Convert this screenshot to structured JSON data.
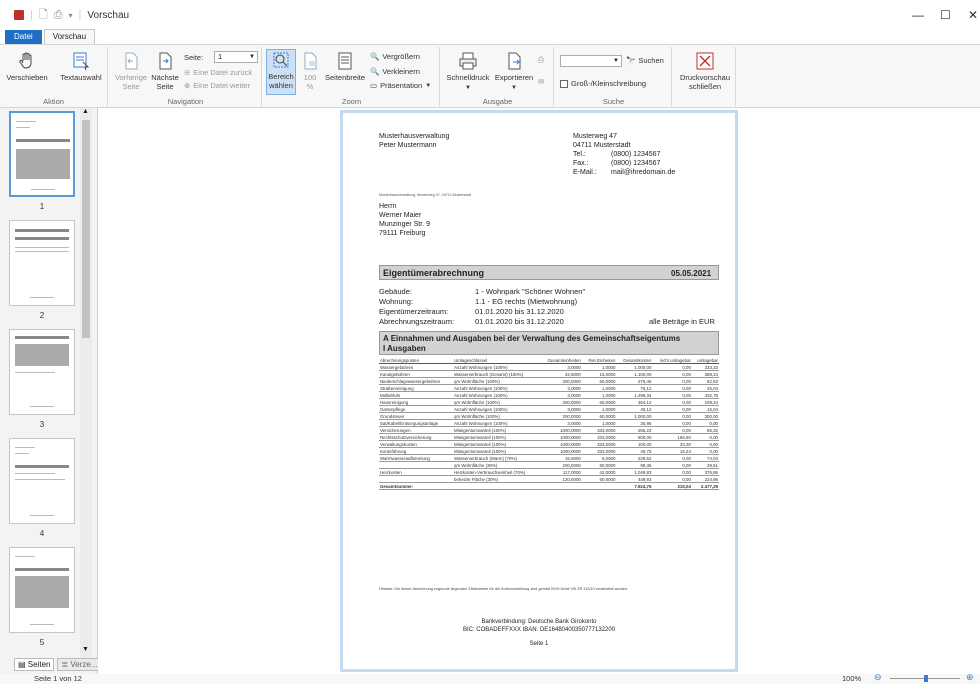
{
  "window": {
    "title": "Vorschau"
  },
  "tabs": {
    "file": "Datei",
    "preview": "Vorschau"
  },
  "ribbon": {
    "aktion": {
      "label": "Aktion",
      "move": "Verschieben",
      "text_select": "Textauswahl"
    },
    "navigation": {
      "label": "Navigation",
      "prev_page_1": "Vorherige",
      "prev_page_2": "Seite",
      "next_page_1": "Nächste",
      "next_page_2": "Seite",
      "page_label": "Seite:",
      "page_value": "1",
      "file_back": "Eine Datei zurück",
      "file_forward": "Eine Datei weiter"
    },
    "zoom": {
      "label": "Zoom",
      "area_1": "Bereich",
      "area_2": "wählen",
      "hundred_1": "100",
      "hundred_2": "%",
      "page_width": "Seitenbreite",
      "zoom_in": "Vergrößern",
      "zoom_out": "Verkleinern",
      "presentation": "Präsentation"
    },
    "ausgabe": {
      "label": "Ausgabe",
      "quick_print": "Schnelldruck",
      "export": "Exportieren"
    },
    "suche": {
      "label": "Suche",
      "search": "Suchen",
      "case": "Groß-/Kleinschreibung",
      "search_value": ""
    },
    "close": {
      "line1": "Druckvorschau",
      "line2": "schließen"
    }
  },
  "sidebar": {
    "pages": [
      "1",
      "2",
      "3",
      "4",
      "5"
    ],
    "tab_pages": "Seiten",
    "tab_directory": "Verze..."
  },
  "status": {
    "page_info": "Seite 1 von 12",
    "zoom": "100%"
  },
  "document": {
    "sender_name": "Musterhausverwaltung",
    "sender_person": "Peter Mustermann",
    "sender_street": "Musterweg 47",
    "sender_city": "04711 Musterstadt",
    "tel_label": "Tel.:",
    "tel": "(0800) 1234567",
    "fax_label": "Fax.:",
    "fax": "(0800) 1234567",
    "mail_label": "E-Mail.:",
    "mail": "mail@ihredomain.de",
    "return_line": "Musterhausverwaltung, Musterweg 47, 04711 Musterstadt",
    "recipient": [
      "Herrn",
      "Werner Maier",
      "Munzinger Str. 9",
      "79111 Freiburg"
    ],
    "heading": "Eigentümerabrechnung",
    "heading_date": "05.05.2021",
    "building_label": "Gebäude:",
    "building": "1 - Wohnpark \"Schöner Wohnen\"",
    "apartment_label": "Wohnung:",
    "apartment": "1.1 - EG rechts (Mietwohnung)",
    "owner_period_label": "Eigentümerzeitraum:",
    "owner_period": "01.01.2020 bis 31.12.2020",
    "billing_period_label": "Abrechnungszeitraum:",
    "billing_period": "01.01.2020 bis 31.12.2020",
    "currency_note": "alle Beträge in EUR",
    "section_title_1": "A Einnahmen und Ausgaben bei der Verwaltung des Gemeinschaftseigentums",
    "section_title_2": "I Ausgaben",
    "table_headers": [
      "Abrechnungsposten",
      "Umlageschlüssel",
      "Gesamteinheiten",
      "Ihre Einheiten",
      "Gesamtkosten",
      "nicht umlagebar",
      "umlagebar"
    ],
    "table_rows": [
      [
        "Wassergebühren",
        "Anzahl Wohnungen (100%)",
        "3,0000",
        "1,0000",
        "1.000,00",
        "0,00",
        "333,33"
      ],
      [
        "Kanalgebühren",
        "Wasserverbrauch (Gesamt) (100%)",
        "42,5000",
        "15,0000",
        "1.100,00",
        "0,00",
        "388,24"
      ],
      [
        "Niederschlagswassergebühren",
        "qm Wohnfläche (100%)",
        "200,0000",
        "60,0000",
        "276,45",
        "0,00",
        "82,93"
      ],
      [
        "Straßenreinigung",
        "Anzahl Wohnungen (100%)",
        "3,0000",
        "1,0000",
        "75,12",
        "0,00",
        "25,04"
      ],
      [
        "Müllabfuhr",
        "Anzahl Wohnungen (100%)",
        "3,0000",
        "1,0000",
        "1.298,34",
        "0,00",
        "432,78"
      ],
      [
        "Hausreinigung",
        "qm Wohnfläche (100%)",
        "200,0000",
        "60,0000",
        "364,12",
        "0,00",
        "109,24"
      ],
      [
        "Gartenpflege",
        "Anzahl Wohnungen (100%)",
        "3,0000",
        "1,0000",
        "45,12",
        "0,00",
        "15,04"
      ],
      [
        "Grundsteuer",
        "qm Wohnfläche (100%)",
        "200,0000",
        "60,0000",
        "1.000,00",
        "0,00",
        "300,00"
      ],
      [
        "Sat/Kabel/Entsorgungsanlage",
        "Anzahl Wohnungen (100%)",
        "3,0000",
        "1,0000",
        "35,96",
        "0,00",
        "0,00"
      ],
      [
        "Versicherungen",
        "Miteigentumsanteil (100%)",
        "1000,0000",
        "333,0000",
        "256,23",
        "0,00",
        "85,32"
      ],
      [
        "Rechtsschutzversicherung",
        "Miteigentumsanteil (100%)",
        "1000,0000",
        "333,0000",
        "500,00",
        "166,50",
        "0,00"
      ],
      [
        "Verwaltungskosten",
        "Miteigentumsanteil (100%)",
        "1000,0000",
        "333,0000",
        "100,00",
        "33,30",
        "0,00"
      ],
      [
        "Kontoführung",
        "Miteigentumsanteil (100%)",
        "1000,0000",
        "333,0000",
        "45,75",
        "15,24",
        "0,00"
      ],
      [
        "Warmwasseraufbereitung",
        "Wasserverbrauch (Warm) (70%)",
        "15,5000",
        "5,0000",
        "229,52",
        "0,00",
        "74,04"
      ],
      [
        "",
        "qm Wohnfläche (30%)",
        "200,0000",
        "60,0000",
        "98,36",
        "0,00",
        "29,51"
      ],
      [
        "Heizkosten",
        "Heizkosten-Verbrauchseinheit (70%)",
        "117,0000",
        "42,0000",
        "1.049,83",
        "0,00",
        "376,86"
      ],
      [
        "",
        "beheizte Fläche (30%)",
        "120,0000",
        "60,0000",
        "449,93",
        "0,00",
        "224,96"
      ]
    ],
    "total_row": [
      "Gesamtsumme:",
      "",
      "",
      "",
      "7.924,76",
      "215,04",
      "2.477,29"
    ],
    "notice": "Hinweis: Die dieser Abrechnung zugrunde liegenden Zählerwerte für die Kostenverteilung sind gemäß BGH Urteil VIII ZR 112/10 verarbeitet worden.",
    "bank_line1": "Bankverbindung: Deutsche Bank Girokonto",
    "bank_line2": "BIC: COBADEFFXXX IBAN: DE16480400350777132200",
    "page_footer": "Seite 1"
  }
}
